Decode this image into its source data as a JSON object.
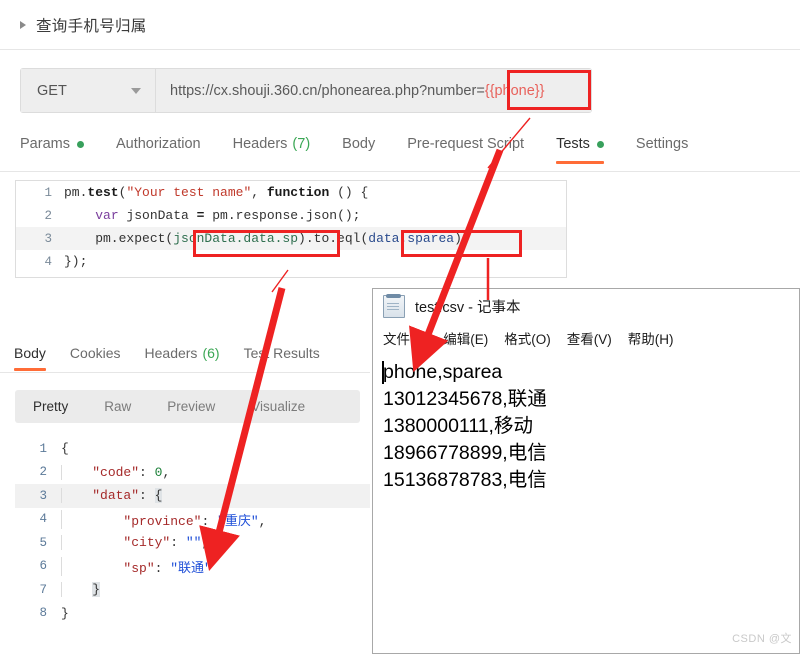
{
  "request": {
    "title": "查询手机号归属",
    "caret_icon": "triangle-right-icon",
    "method": "GET",
    "method_chevron_icon": "chevron-down-icon",
    "url_base": "https://cx.shouji.360.cn/phonearea.php?number=",
    "url_variable": "{{phone}}"
  },
  "request_tabs": [
    {
      "label": "Params",
      "badge_dot": true,
      "active": false
    },
    {
      "label": "Authorization",
      "badge_dot": false,
      "active": false
    },
    {
      "label": "Headers",
      "count": "(7)",
      "badge_dot": false,
      "active": false
    },
    {
      "label": "Body",
      "badge_dot": false,
      "active": false
    },
    {
      "label": "Pre-request Script",
      "badge_dot": false,
      "active": false
    },
    {
      "label": "Tests",
      "badge_dot": true,
      "active": true
    },
    {
      "label": "Settings",
      "badge_dot": false,
      "active": false
    }
  ],
  "test_script": {
    "lines": [
      {
        "n": "1",
        "text": "pm.test(\"Your test name\", function () {"
      },
      {
        "n": "2",
        "text": "    var jsonData = pm.response.json();"
      },
      {
        "n": "3",
        "text": "    pm.expect(jsonData.data.sp).to.eql(data.sparea);"
      },
      {
        "n": "4",
        "text": "});"
      }
    ]
  },
  "response_tabs": [
    {
      "label": "Body",
      "active": true
    },
    {
      "label": "Cookies",
      "active": false
    },
    {
      "label": "Headers",
      "count": "(6)",
      "active": false
    },
    {
      "label": "Test Results",
      "active": false
    }
  ],
  "response_subtabs": [
    {
      "label": "Pretty",
      "active": true
    },
    {
      "label": "Raw",
      "active": false
    },
    {
      "label": "Preview",
      "active": false
    },
    {
      "label": "Visualize",
      "active": false
    }
  ],
  "response_body": {
    "lines": [
      {
        "n": "1",
        "text": "{"
      },
      {
        "n": "2",
        "text": "    \"code\": 0,"
      },
      {
        "n": "3",
        "text": "    \"data\": {"
      },
      {
        "n": "4",
        "text": "        \"province\": \"重庆\","
      },
      {
        "n": "5",
        "text": "        \"city\": \"\","
      },
      {
        "n": "6",
        "text": "        \"sp\": \"联通\""
      },
      {
        "n": "7",
        "text": "    }"
      },
      {
        "n": "8",
        "text": "}"
      }
    ]
  },
  "notepad": {
    "icon": "notepad-icon",
    "title": "test.csv - 记事本",
    "menu": [
      "文件(F)",
      "编辑(E)",
      "格式(O)",
      "查看(V)",
      "帮助(H)"
    ],
    "content": [
      "phone,sparea",
      "13012345678,联通",
      "1380000111,移动",
      "18966778899,电信",
      "15136878783,电信"
    ]
  },
  "annotations": {
    "color": "#ee2222",
    "boxes": [
      "url-variable-box",
      "jsondata-sp-box",
      "data-sparea-box"
    ],
    "arrows": [
      "arrow-sp-to-response",
      "arrow-sparea-to-csv"
    ]
  },
  "watermark": "CSDN @文",
  "colors": {
    "accent": "#ff6c37",
    "ok_dot": "#38a05c",
    "count": "#3ba755",
    "annotation": "#ee2222"
  }
}
